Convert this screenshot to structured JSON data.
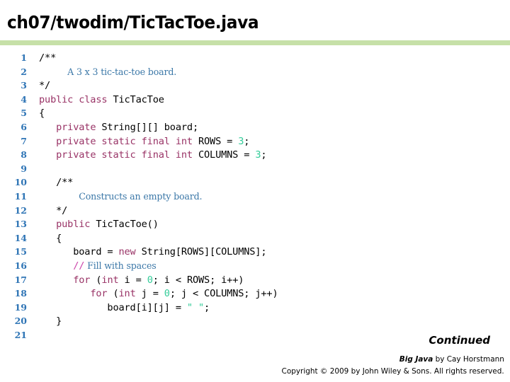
{
  "slide": {
    "title": "ch07/twodim/TicTacToe.java",
    "rule_color": "#c6e0a8"
  },
  "colors": {
    "line_number": "#2e74b5",
    "keyword": "#993366",
    "literal": "#33cc99",
    "comment": "#3c78a8",
    "comment_marker": "#cc44aa",
    "plain": "#000000"
  },
  "code": {
    "lines": [
      {
        "n": "1",
        "tokens": [
          {
            "t": "/**",
            "c": "plain"
          }
        ]
      },
      {
        "n": "2",
        "tokens": [
          {
            "t": "     ",
            "c": "plain"
          },
          {
            "t": "A 3 x 3 tic-tac-toe board.",
            "c": "cmt"
          }
        ]
      },
      {
        "n": "3",
        "tokens": [
          {
            "t": "*/",
            "c": "plain"
          }
        ]
      },
      {
        "n": "4",
        "tokens": [
          {
            "t": "public class",
            "c": "kw"
          },
          {
            "t": " TicTacToe",
            "c": "plain"
          }
        ]
      },
      {
        "n": "5",
        "tokens": [
          {
            "t": "{",
            "c": "plain"
          }
        ]
      },
      {
        "n": "6",
        "tokens": [
          {
            "t": "   ",
            "c": "plain"
          },
          {
            "t": "private",
            "c": "kw"
          },
          {
            "t": " String[][] board;",
            "c": "plain"
          }
        ]
      },
      {
        "n": "7",
        "tokens": [
          {
            "t": "   ",
            "c": "plain"
          },
          {
            "t": "private static final int",
            "c": "kw"
          },
          {
            "t": " ROWS = ",
            "c": "plain"
          },
          {
            "t": "3",
            "c": "lit"
          },
          {
            "t": ";",
            "c": "plain"
          }
        ]
      },
      {
        "n": "8",
        "tokens": [
          {
            "t": "   ",
            "c": "plain"
          },
          {
            "t": "private static final int",
            "c": "kw"
          },
          {
            "t": " COLUMNS = ",
            "c": "plain"
          },
          {
            "t": "3",
            "c": "lit"
          },
          {
            "t": ";",
            "c": "plain"
          }
        ]
      },
      {
        "n": "9",
        "tokens": [
          {
            "t": "",
            "c": "plain"
          }
        ]
      },
      {
        "n": "10",
        "tokens": [
          {
            "t": "   /**",
            "c": "plain"
          }
        ]
      },
      {
        "n": "11",
        "tokens": [
          {
            "t": "       ",
            "c": "plain"
          },
          {
            "t": "Constructs an empty board.",
            "c": "cmt"
          }
        ]
      },
      {
        "n": "12",
        "tokens": [
          {
            "t": "   */",
            "c": "plain"
          }
        ]
      },
      {
        "n": "13",
        "tokens": [
          {
            "t": "   ",
            "c": "plain"
          },
          {
            "t": "public",
            "c": "kw"
          },
          {
            "t": " TicTacToe()",
            "c": "plain"
          }
        ]
      },
      {
        "n": "14",
        "tokens": [
          {
            "t": "   {",
            "c": "plain"
          }
        ]
      },
      {
        "n": "15",
        "tokens": [
          {
            "t": "      board = ",
            "c": "plain"
          },
          {
            "t": "new",
            "c": "kw"
          },
          {
            "t": " String[ROWS][COLUMNS];",
            "c": "plain"
          }
        ]
      },
      {
        "n": "16",
        "tokens": [
          {
            "t": "      ",
            "c": "plain"
          },
          {
            "t": "//",
            "c": "cmtmark"
          },
          {
            "t": " Fill with spaces",
            "c": "cmt"
          }
        ]
      },
      {
        "n": "17",
        "tokens": [
          {
            "t": "      ",
            "c": "plain"
          },
          {
            "t": "for",
            "c": "kw"
          },
          {
            "t": " (",
            "c": "plain"
          },
          {
            "t": "int",
            "c": "kw"
          },
          {
            "t": " i = ",
            "c": "plain"
          },
          {
            "t": "0",
            "c": "lit"
          },
          {
            "t": "; i < ROWS; i++)",
            "c": "plain"
          }
        ]
      },
      {
        "n": "18",
        "tokens": [
          {
            "t": "         ",
            "c": "plain"
          },
          {
            "t": "for",
            "c": "kw"
          },
          {
            "t": " (",
            "c": "plain"
          },
          {
            "t": "int",
            "c": "kw"
          },
          {
            "t": " j = ",
            "c": "plain"
          },
          {
            "t": "0",
            "c": "lit"
          },
          {
            "t": "; j < COLUMNS; j++)",
            "c": "plain"
          }
        ]
      },
      {
        "n": "19",
        "tokens": [
          {
            "t": "            board[i][j] = ",
            "c": "plain"
          },
          {
            "t": "\" \"",
            "c": "lit"
          },
          {
            "t": ";",
            "c": "plain"
          }
        ]
      },
      {
        "n": "20",
        "tokens": [
          {
            "t": "   }",
            "c": "plain"
          }
        ]
      },
      {
        "n": "21",
        "tokens": [
          {
            "t": "",
            "c": "plain"
          }
        ]
      }
    ]
  },
  "footer": {
    "continued": "Continued",
    "book_title": "Big Java",
    "credit_rest": " by Cay Horstmann",
    "copyright": "Copyright © 2009 by John Wiley & Sons.  All rights reserved."
  }
}
